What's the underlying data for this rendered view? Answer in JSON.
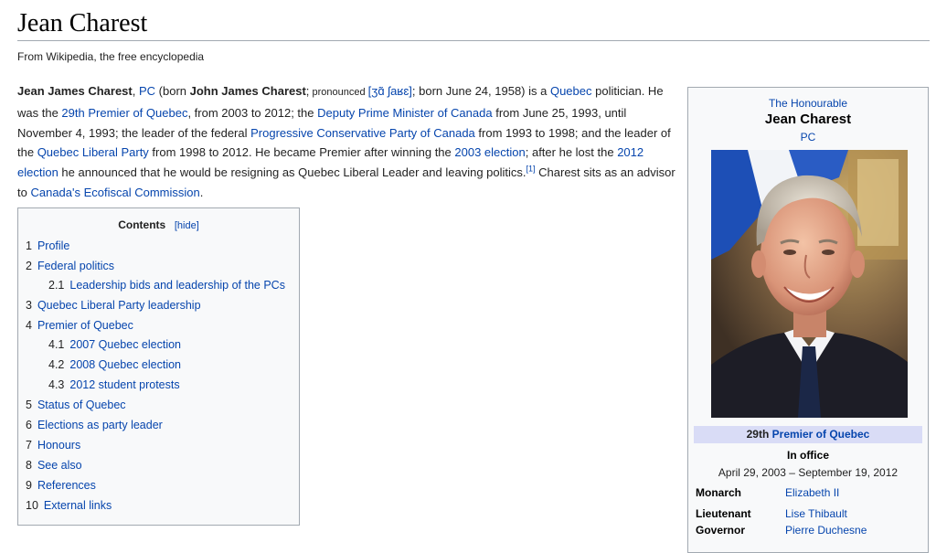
{
  "page": {
    "title": "Jean Charest",
    "tagline": "From Wikipedia, the free encyclopedia"
  },
  "lead": {
    "name_bold": "Jean James Charest",
    "pc_link": "PC",
    "born_prefix": " (born ",
    "birth_name": "John James Charest",
    "semicolon": ";",
    "pronounced": " pronounced ",
    "ipa": "[ʒɑ̃ ʃaʁɛ]",
    "after_ipa": "; born June 24, 1958) is a ",
    "quebec_link": "Quebec",
    "t1": " politician. He was the ",
    "premier_link": "29th Premier of Quebec",
    "t2": ", from 2003 to 2012; the ",
    "deputy_link": "Deputy Prime Minister of Canada",
    "t3": " from June 25, 1993, until November 4, 1993; the leader of the federal ",
    "pcparty_link": "Progressive Conservative Party of Canada",
    "t4": " from 1993 to 1998; and the leader of the ",
    "qlp_link": "Quebec Liberal Party",
    "t5": " from 1998 to 2012. He became Premier after winning the ",
    "election2003_link": "2003 election",
    "t6": "; after he lost the ",
    "election2012_link": "2012 election",
    "t7": " he announced that he would be resigning as Quebec Liberal Leader and leaving politics.",
    "ref1": "[1]",
    "t8": " Charest sits as an advisor to ",
    "ecofiscal_link": "Canada's Ecofiscal Commission",
    "t9": "."
  },
  "toc": {
    "title": "Contents",
    "hide": "[hide]",
    "items": [
      {
        "num": "1",
        "label": "Profile"
      },
      {
        "num": "2",
        "label": "Federal politics"
      },
      {
        "num": "2.1",
        "label": "Leadership bids and leadership of the PCs"
      },
      {
        "num": "3",
        "label": "Quebec Liberal Party leadership"
      },
      {
        "num": "4",
        "label": "Premier of Quebec"
      },
      {
        "num": "4.1",
        "label": "2007 Quebec election"
      },
      {
        "num": "4.2",
        "label": "2008 Quebec election"
      },
      {
        "num": "4.3",
        "label": "2012 student protests"
      },
      {
        "num": "5",
        "label": "Status of Quebec"
      },
      {
        "num": "6",
        "label": "Elections as party leader"
      },
      {
        "num": "7",
        "label": "Honours"
      },
      {
        "num": "8",
        "label": "See also"
      },
      {
        "num": "9",
        "label": "References"
      },
      {
        "num": "10",
        "label": "External links"
      }
    ]
  },
  "infobox": {
    "honorific": "The Honourable",
    "name": "Jean Charest",
    "post_nominal": "PC",
    "office_number": "29th ",
    "office_link": "Premier of Quebec",
    "in_office": "In office",
    "dates": "April 29, 2003 – September 19, 2012",
    "monarch_label": "Monarch",
    "monarch_value": "Elizabeth II",
    "lg_label_1": "Lieutenant",
    "lg_label_2": "Governor",
    "lg_value_1": "Lise Thibault",
    "lg_value_2": "Pierre Duchesne"
  },
  "colors": {
    "link": "#0645ad",
    "office_bar": "#d9dcf6",
    "toc_bg": "#f8f9fa",
    "border": "#a2a9b1"
  }
}
